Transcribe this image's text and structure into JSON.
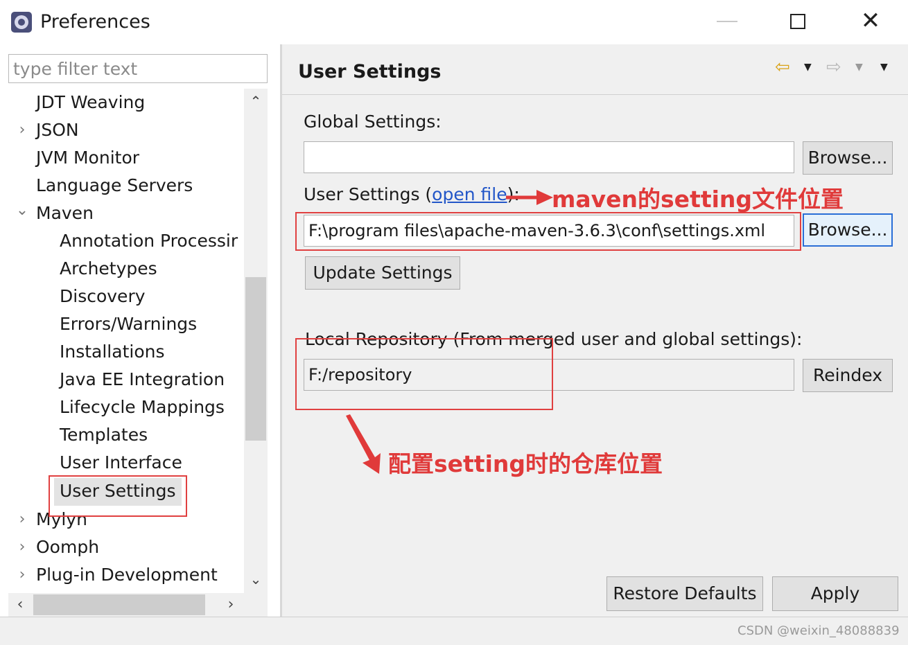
{
  "window": {
    "title": "Preferences",
    "min_icon": "minimize-icon",
    "max_icon": "maximize-icon",
    "close_glyph": "✕"
  },
  "filter": {
    "placeholder": "type filter text"
  },
  "tree": {
    "items": [
      {
        "label": "JDT Weaving",
        "twisty": ""
      },
      {
        "label": "JSON",
        "twisty": "›"
      },
      {
        "label": "JVM Monitor",
        "twisty": ""
      },
      {
        "label": "Language Servers",
        "twisty": ""
      },
      {
        "label": "Maven",
        "twisty": "⌄"
      },
      {
        "label": "Annotation Processir",
        "twisty": ""
      },
      {
        "label": "Archetypes",
        "twisty": ""
      },
      {
        "label": "Discovery",
        "twisty": ""
      },
      {
        "label": "Errors/Warnings",
        "twisty": ""
      },
      {
        "label": "Installations",
        "twisty": ""
      },
      {
        "label": "Java EE Integration",
        "twisty": ""
      },
      {
        "label": "Lifecycle Mappings",
        "twisty": ""
      },
      {
        "label": "Templates",
        "twisty": ""
      },
      {
        "label": "User Interface",
        "twisty": ""
      },
      {
        "label": "User Settings",
        "twisty": ""
      },
      {
        "label": "Mylyn",
        "twisty": "›"
      },
      {
        "label": "Oomph",
        "twisty": "›"
      },
      {
        "label": "Plug-in Development",
        "twisty": "›"
      }
    ],
    "selected": "User Settings"
  },
  "page": {
    "title": "User Settings",
    "nav": {
      "back": "⇦",
      "dropdown": "▼",
      "forward": "⇨",
      "menu": "▼"
    },
    "global_settings_label": "Global Settings:",
    "global_settings_value": "",
    "browse_label": "Browse...",
    "user_settings_label_prefix": "User Settings (",
    "user_settings_link": "open file",
    "user_settings_label_suffix": "):",
    "user_settings_value": "F:\\program files\\apache-maven-3.6.3\\conf\\settings.xml",
    "update_button": "Update Settings",
    "local_repo_label": "Local Repository (From merged user and global settings):",
    "local_repo_value": "F:/repository",
    "reindex_button": "Reindex",
    "restore_button": "Restore Defaults",
    "apply_button": "Apply"
  },
  "annotations": {
    "user_settings_note": "maven的setting文件位置",
    "repo_note": "配置setting时的仓库位置",
    "color": "#e03a3a"
  },
  "watermark": "CSDN @weixin_48088839"
}
